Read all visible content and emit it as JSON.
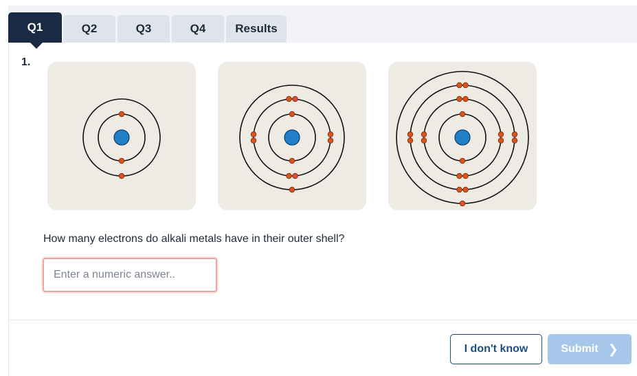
{
  "tabs": [
    {
      "label": "Q1",
      "active": true
    },
    {
      "label": "Q2",
      "active": false
    },
    {
      "label": "Q3",
      "active": false
    },
    {
      "label": "Q4",
      "active": false
    },
    {
      "label": "Results",
      "active": false
    }
  ],
  "question": {
    "number": "1.",
    "text": "How many electrons do alkali metals have in their outer shell?"
  },
  "answer": {
    "placeholder": "Enter a numeric answer..",
    "value": ""
  },
  "atoms": [
    {
      "name": "atom-diagram-lithium",
      "shells": [
        2,
        1
      ]
    },
    {
      "name": "atom-diagram-sodium",
      "shells": [
        2,
        8,
        1
      ]
    },
    {
      "name": "atom-diagram-potassium",
      "shells": [
        2,
        8,
        8,
        1
      ]
    }
  ],
  "buttons": {
    "dont_know": "I don't know",
    "submit": "Submit",
    "submit_icon": "chevron-right-icon"
  },
  "colors": {
    "active_tab": "#1b2a44",
    "tab": "#dfe4ec",
    "nucleus": "#1f7fc9",
    "electron": "#d9541e",
    "atom_background": "#eeebe4",
    "submit_disabled": "#a7c7ea",
    "input_error_border": "#e8a6a6"
  }
}
